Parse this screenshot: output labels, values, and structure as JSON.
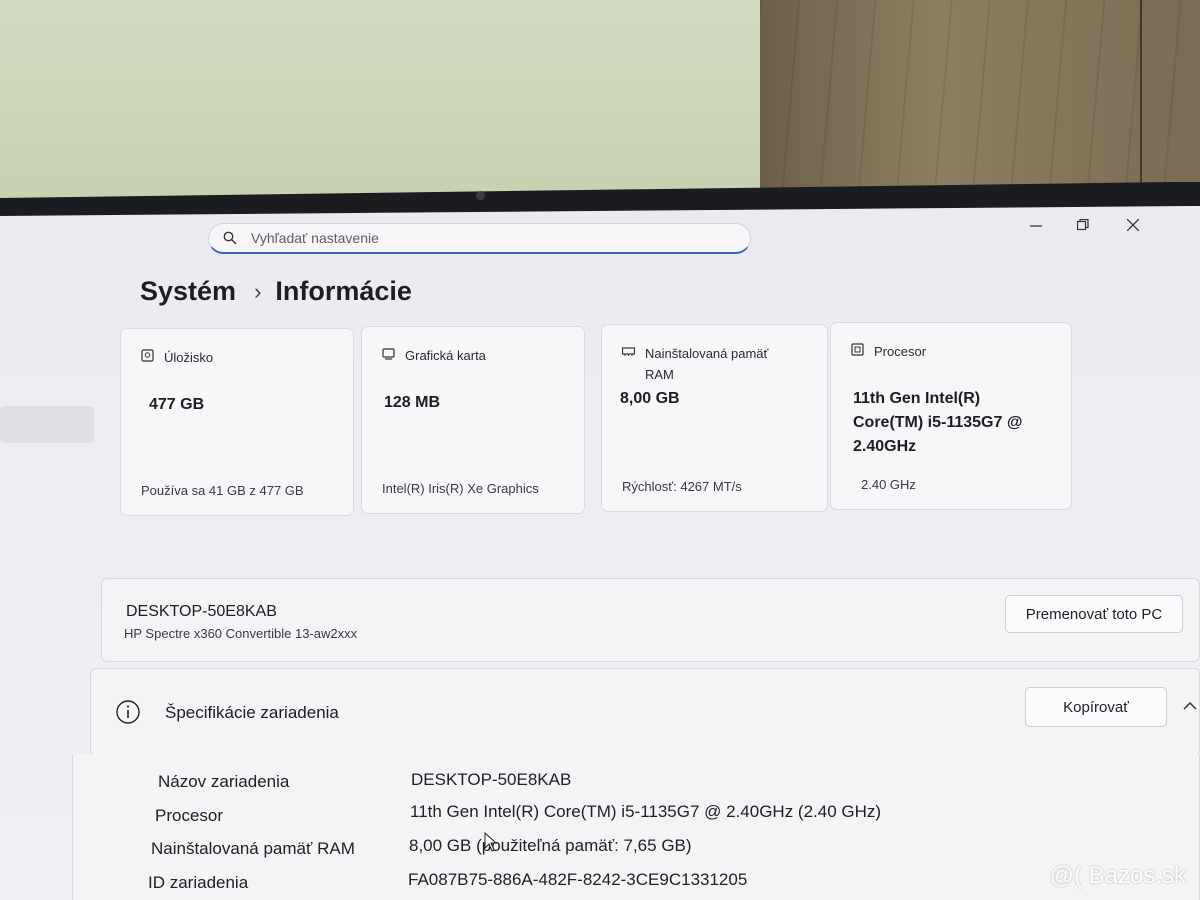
{
  "search": {
    "placeholder": "Vyhľadať nastavenie"
  },
  "breadcrumb": {
    "parent": "Systém",
    "current": "Informácie"
  },
  "cards": [
    {
      "title": "Úložisko",
      "value": "477 GB",
      "detail": "Používa sa 41 GB z 477 GB",
      "icon": "storage-icon"
    },
    {
      "title": "Grafická karta",
      "value": "128 MB",
      "detail": "Intel(R) Iris(R) Xe Graphics",
      "icon": "gpu-icon"
    },
    {
      "title_line1": "Nainštalovaná pamäť",
      "title_line2": "RAM",
      "value": "8,00 GB",
      "detail": "Rýchlosť: 4267 MT/s",
      "icon": "memory-icon"
    },
    {
      "title": "Procesor",
      "value_line1": "11th Gen Intel(R)",
      "value_line2": "Core(TM) i5-1135G7 @",
      "value_line3": "2.40GHz",
      "detail": "2.40 GHz",
      "icon": "cpu-icon"
    }
  ],
  "device": {
    "name": "DESKTOP-50E8KAB",
    "model": "HP Spectre x360 Convertible 13-aw2xxx",
    "rename_label": "Premenovať toto PC"
  },
  "specs": {
    "title": "Špecifikácie zariadenia",
    "copy_label": "Kopírovať",
    "rows": [
      {
        "label": "Názov zariadenia",
        "value": "DESKTOP-50E8KAB"
      },
      {
        "label": "Procesor",
        "value": "11th Gen Intel(R) Core(TM) i5-1135G7 @ 2.40GHz (2.40 GHz)"
      },
      {
        "label": "Nainštalovaná pamäť RAM",
        "value": "8,00 GB (použiteľná pamäť: 7,65 GB)"
      },
      {
        "label": "ID zariadenia",
        "value": "FA087B75-886A-482F-8242-3CE9C1331205"
      }
    ]
  },
  "watermark": "@( Bazos.sk",
  "colors": {
    "accent": "#3b63b5",
    "card_bg": "#f7f6f9",
    "screen_bg": "#eceaf0"
  }
}
